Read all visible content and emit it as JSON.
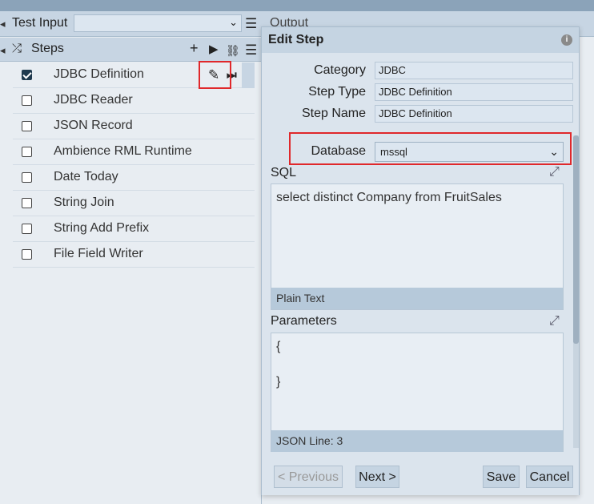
{
  "header": {
    "test_input_label": "Test Input",
    "test_input_value": "",
    "output_label": "Output"
  },
  "steps_panel": {
    "title": "Steps",
    "items": [
      {
        "label": "JDBC Definition",
        "checked": true
      },
      {
        "label": "JDBC Reader",
        "checked": false
      },
      {
        "label": "JSON Record",
        "checked": false
      },
      {
        "label": "Ambience RML Runtime",
        "checked": false
      },
      {
        "label": "Date Today",
        "checked": false
      },
      {
        "label": "String Join",
        "checked": false
      },
      {
        "label": "String Add Prefix",
        "checked": false
      },
      {
        "label": "File Field Writer",
        "checked": false
      }
    ]
  },
  "dialog": {
    "title": "Edit Step",
    "category_label": "Category",
    "category_value": "JDBC",
    "step_type_label": "Step Type",
    "step_type_value": "JDBC Definition",
    "step_name_label": "Step Name",
    "step_name_value": "JDBC Definition",
    "database_label": "Database",
    "database_value": "mssql",
    "sql_label": "SQL",
    "sql_value": "select distinct Company from FruitSales",
    "sql_mode": "Plain Text",
    "parameters_label": "Parameters",
    "parameters_value": "{\n\n}",
    "parameters_status": "JSON Line: 3",
    "buttons": {
      "previous": "< Previous",
      "next": "Next >",
      "save": "Save",
      "cancel": "Cancel"
    }
  },
  "colors": {
    "highlight": "#e0282b",
    "header_bg": "#c7d5e3",
    "dialog_bg": "#dbe4ed"
  }
}
